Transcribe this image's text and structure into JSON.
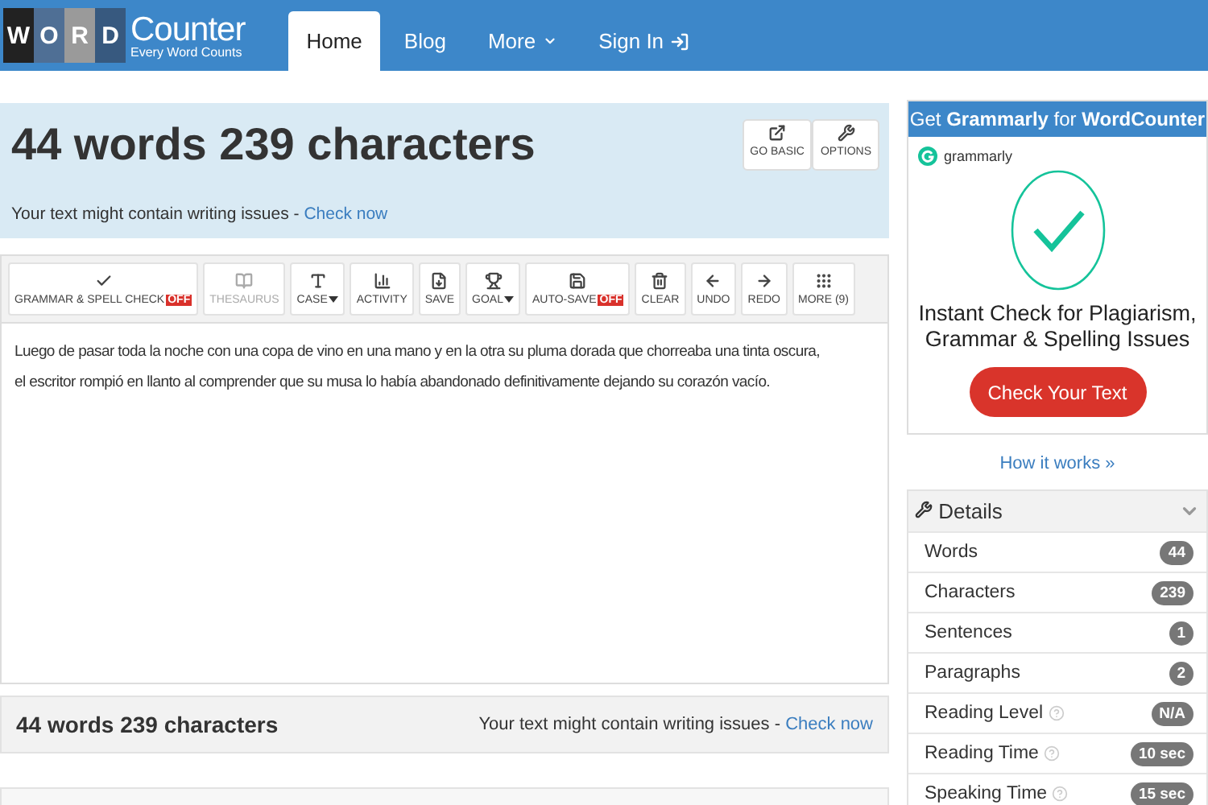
{
  "nav": {
    "logo_letters": [
      "W",
      "O",
      "R",
      "D"
    ],
    "logo_title": "Counter",
    "logo_tagline": "Every Word Counts",
    "items": [
      {
        "label": "Home",
        "selected": true,
        "kind": "link"
      },
      {
        "label": "Blog",
        "selected": false,
        "kind": "link"
      },
      {
        "label": "More",
        "selected": false,
        "kind": "dropdown"
      },
      {
        "label": "Sign In",
        "selected": false,
        "kind": "signin"
      }
    ]
  },
  "header": {
    "title": "44 words 239 characters",
    "notice": "Your text might contain writing issues - ",
    "notice_link": "Check now",
    "buttons": [
      {
        "label": "GO BASIC",
        "kind": "external"
      },
      {
        "label": "OPTIONS",
        "kind": "wrench"
      }
    ]
  },
  "toolbar": [
    {
      "label": "GRAMMAR & SPELL CHECK",
      "kind": "check",
      "badge": "OFF",
      "disabled": false
    },
    {
      "label": "THESAURUS",
      "kind": "book",
      "disabled": true
    },
    {
      "label": "CASE",
      "kind": "case",
      "caret": true,
      "disabled": false
    },
    {
      "label": "ACTIVITY",
      "kind": "chart",
      "disabled": false
    },
    {
      "label": "SAVE",
      "kind": "file",
      "disabled": false
    },
    {
      "label": "GOAL",
      "kind": "trophy",
      "caret": true,
      "disabled": false
    },
    {
      "label": "AUTO-SAVE",
      "kind": "save",
      "badge": "OFF",
      "disabled": false
    },
    {
      "label": "CLEAR",
      "kind": "trash",
      "disabled": false
    },
    {
      "label": "UNDO",
      "kind": "left",
      "disabled": false
    },
    {
      "label": "REDO",
      "kind": "right",
      "disabled": false
    },
    {
      "label": "MORE (9)",
      "kind": "grid",
      "disabled": false
    }
  ],
  "editor": {
    "paragraphs": [
      "Luego de pasar toda la noche con una copa de vino en una mano y en la otra su pluma dorada que chorreaba una tinta oscura,",
      "el escritor rompió en llanto al comprender que su musa lo había abandonado definitivamente dejando su corazón vacío."
    ]
  },
  "footer": {
    "title": "44 words 239 characters",
    "notice": "Your text might contain writing issues - ",
    "notice_link": "Check now"
  },
  "ad": {
    "header": "Get **Grammarly** for **WordCounter**",
    "brand": "grammarly",
    "headline": "Instant Check for Plagiarism, Grammar & Spelling Issues",
    "button": "Check Your Text",
    "link": "How it works »"
  },
  "details": {
    "title": "Details",
    "expanded": true,
    "rows": [
      {
        "label": "Words",
        "value": "44",
        "help": false
      },
      {
        "label": "Characters",
        "value": "239",
        "help": false
      },
      {
        "label": "Sentences",
        "value": "1",
        "help": false
      },
      {
        "label": "Paragraphs",
        "value": "2",
        "help": false
      },
      {
        "label": "Reading Level",
        "value": "N/A",
        "help": true
      },
      {
        "label": "Reading Time",
        "value": "10 sec",
        "help": true
      },
      {
        "label": "Speaking Time",
        "value": "15 sec",
        "help": true
      }
    ]
  }
}
